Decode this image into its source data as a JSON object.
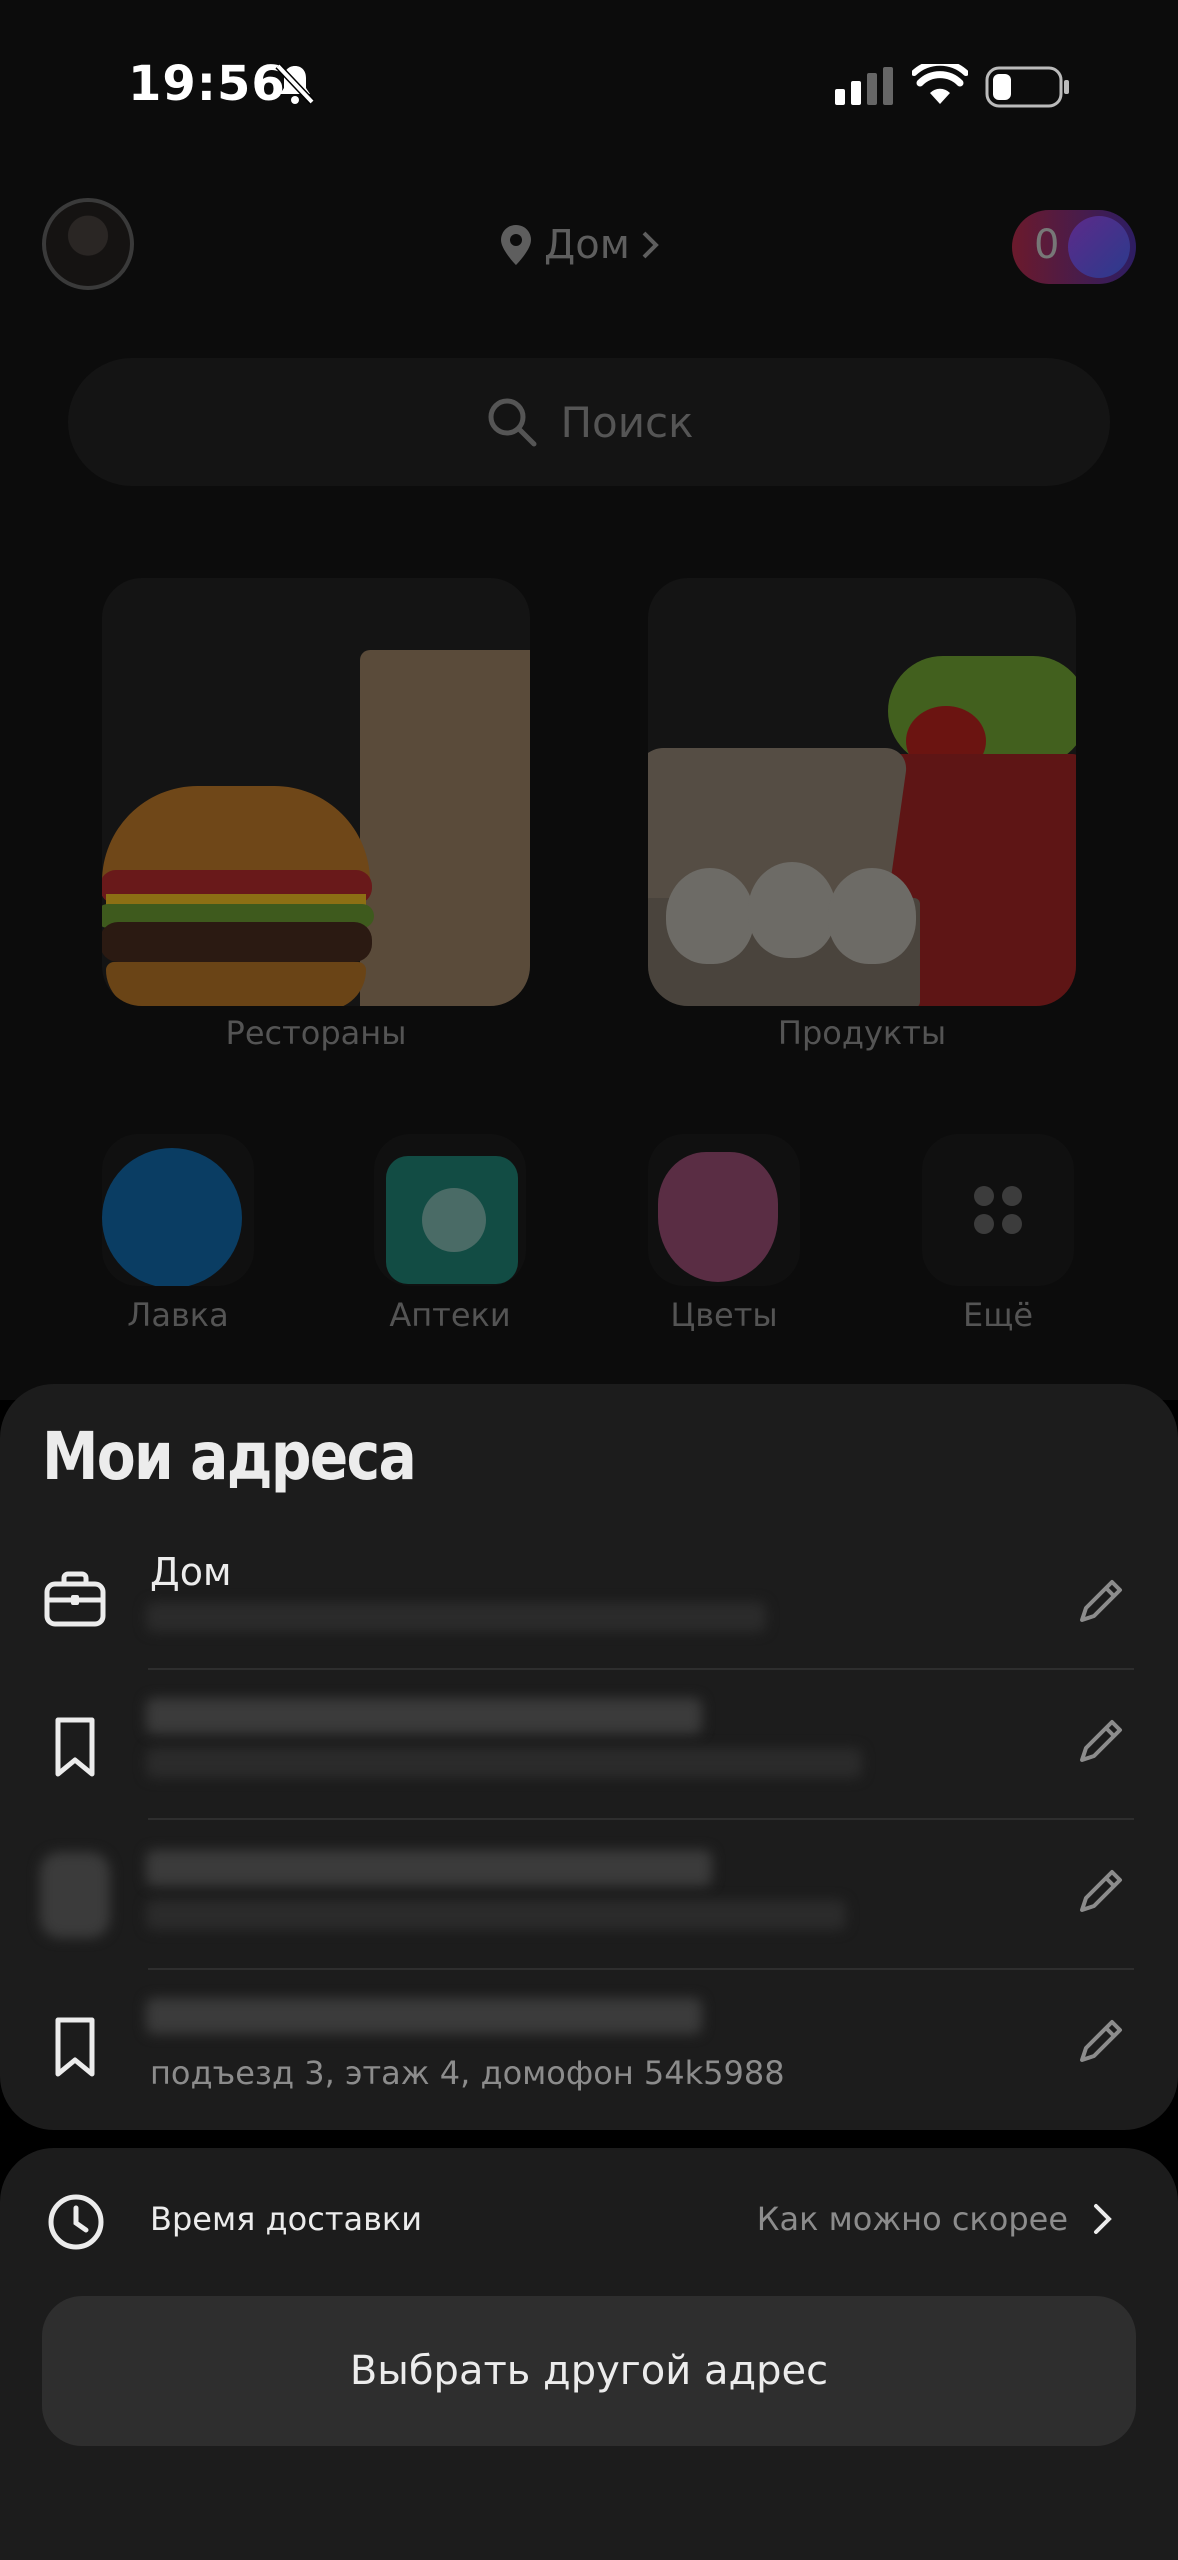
{
  "status_bar": {
    "time": "19:56"
  },
  "header": {
    "location_label": "Дом",
    "plus_points": "0"
  },
  "search": {
    "placeholder": "Поиск"
  },
  "categories": [
    {
      "label": "Рестораны"
    },
    {
      "label": "Продукты"
    }
  ],
  "shortcuts": [
    {
      "label": "Лавка"
    },
    {
      "label": "Аптеки"
    },
    {
      "label": "Цветы"
    },
    {
      "label": "Ещё"
    }
  ],
  "address_sheet": {
    "title": "Мои адреса",
    "addresses": [
      {
        "title": "Дом",
        "icon": "briefcase-icon",
        "details": ""
      },
      {
        "title": "",
        "icon": "bookmark-icon",
        "details": ""
      },
      {
        "title": "",
        "icon": "blurred-icon",
        "details": ""
      },
      {
        "title": "",
        "icon": "bookmark-icon",
        "details": "подъезд 3, этаж 4, домофон 54k5988"
      }
    ]
  },
  "delivery": {
    "label": "Время доставки",
    "value": "Как можно скорее"
  },
  "choose_other_button": "Выбрать другой адрес",
  "colors": {
    "sheet_bg": "#1c1c1c",
    "button_bg": "#2e2e2e",
    "text_primary": "#ececec",
    "text_secondary": "#8c8c8c"
  }
}
